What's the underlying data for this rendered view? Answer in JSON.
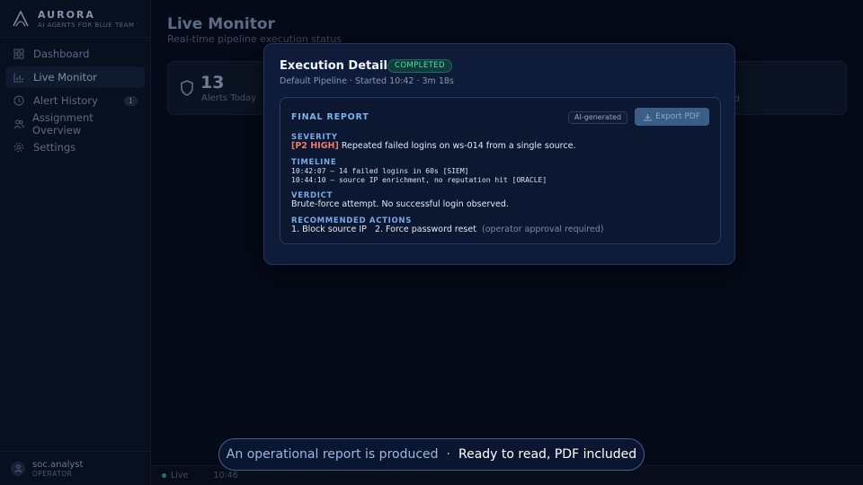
{
  "brand": {
    "name": "AURORA",
    "tagline": "AI AGENTS FOR BLUE TEAM"
  },
  "sidebar": {
    "items": [
      {
        "label": "Dashboard",
        "icon": "grid-icon",
        "active": false
      },
      {
        "label": "Live Monitor",
        "icon": "bar-chart-icon",
        "active": true
      },
      {
        "label": "Alert History",
        "icon": "clock-icon",
        "active": false,
        "count": "1"
      },
      {
        "label": "Assignment Overview",
        "icon": "users-icon",
        "active": false
      },
      {
        "label": "Settings",
        "icon": "gear-icon",
        "active": false
      }
    ]
  },
  "user": {
    "name": "soc.analyst",
    "role": "OPERATOR"
  },
  "main": {
    "title": "Live Monitor",
    "subtitle": "Real-time pipeline execution status",
    "stat": {
      "value": "13",
      "label": "Alerts Today",
      "tail": "d"
    }
  },
  "statusbar": {
    "live": "Live",
    "time": "10:46"
  },
  "modal": {
    "title": "Execution Detail",
    "status": "COMPLETED",
    "subtitle": "Default Pipeline · Started 10:42 · 3m 18s",
    "report": {
      "heading": "FINAL REPORT",
      "ai_chip": "AI-generated",
      "export_label": "Export PDF",
      "severity_label": "SEVERITY",
      "severity_tag": "[P2 HIGH]",
      "severity_text": "Repeated failed logins on ws-014 from a single source.",
      "timeline_label": "TIMELINE",
      "timeline": [
        "10:42:07 — 14 failed logins in 60s [SIEM]",
        "10:44:10 — source IP enrichment, no reputation hit [ORACLE]"
      ],
      "verdict_label": "VERDICT",
      "verdict_text": "Brute-force attempt. No successful login observed.",
      "actions_label": "RECOMMENDED ACTIONS",
      "actions_text": "1. Block source IP   2. Force password reset",
      "actions_note": "(operator approval required)"
    }
  },
  "caption": {
    "part1": "An operational report is produced",
    "separator": "·",
    "part2": "Ready to read, PDF included"
  },
  "colors": {
    "background": "#050a18",
    "modal": "#0e1c3a",
    "accent": "#7eb2e8",
    "success": "#4fe0a6",
    "severity": "#f07a6a"
  }
}
